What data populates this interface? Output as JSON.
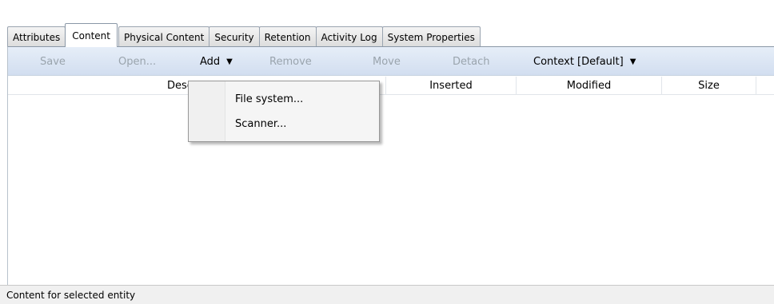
{
  "tabs": [
    "Attributes",
    "Content",
    "Physical Content",
    "Security",
    "Retention",
    "Activity Log",
    "System Properties"
  ],
  "active_tab": "Content",
  "toolbar": {
    "save": "Save",
    "open": "Open...",
    "add": "Add",
    "remove": "Remove",
    "move": "Move",
    "detach": "Detach",
    "context": "Context [Default]"
  },
  "columns": {
    "description": "Description",
    "inserted": "Inserted",
    "modified": "Modified",
    "size": "Size"
  },
  "add_menu": [
    "File system...",
    "Scanner..."
  ],
  "status": "Content for selected entity",
  "colors": {
    "toolbar_gradient_top": "#e6eef8",
    "toolbar_gradient_bottom": "#d2def0",
    "disabled_text": "#9aa4ad"
  },
  "icons": {
    "dropdown": "black-down-triangle"
  }
}
